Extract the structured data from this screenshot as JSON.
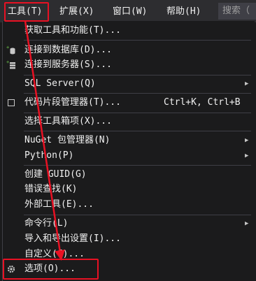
{
  "menubar": {
    "items": [
      "工具(T)",
      "扩展(X)",
      "窗口(W)",
      "帮助(H)"
    ],
    "search_placeholder": "搜索（"
  },
  "menu": {
    "items": [
      {
        "label": "获取工具和功能(T)..."
      },
      {
        "label": "连接到数据库(D)...",
        "icon": "database-icon"
      },
      {
        "label": "连接到服务器(S)...",
        "icon": "server-icon"
      },
      {
        "label": "SQL Server(Q)",
        "submenu": "▶"
      },
      {
        "label": "代码片段管理器(T)...",
        "shortcut": "Ctrl+K, Ctrl+B",
        "icon": "checkbox-icon"
      },
      {
        "label": "选择工具箱项(X)..."
      },
      {
        "label": "NuGet 包管理器(N)",
        "submenu": "▶"
      },
      {
        "label": "Python(P)",
        "submenu": "▶"
      },
      {
        "label": "创建 GUID(G)"
      },
      {
        "label": "错误查找(K)"
      },
      {
        "label": "外部工具(E)..."
      },
      {
        "label": "命令行(L)",
        "submenu": "▶"
      },
      {
        "label": "导入和导出设置(I)..."
      },
      {
        "label": "自定义(C)..."
      },
      {
        "label": "选项(O)...",
        "icon": "gear-icon"
      }
    ]
  },
  "colors": {
    "menu_bg": "#1b1b1c",
    "menubar_bg": "#2d2d30",
    "highlight_red": "#e81123",
    "separator": "#3f3f46"
  }
}
